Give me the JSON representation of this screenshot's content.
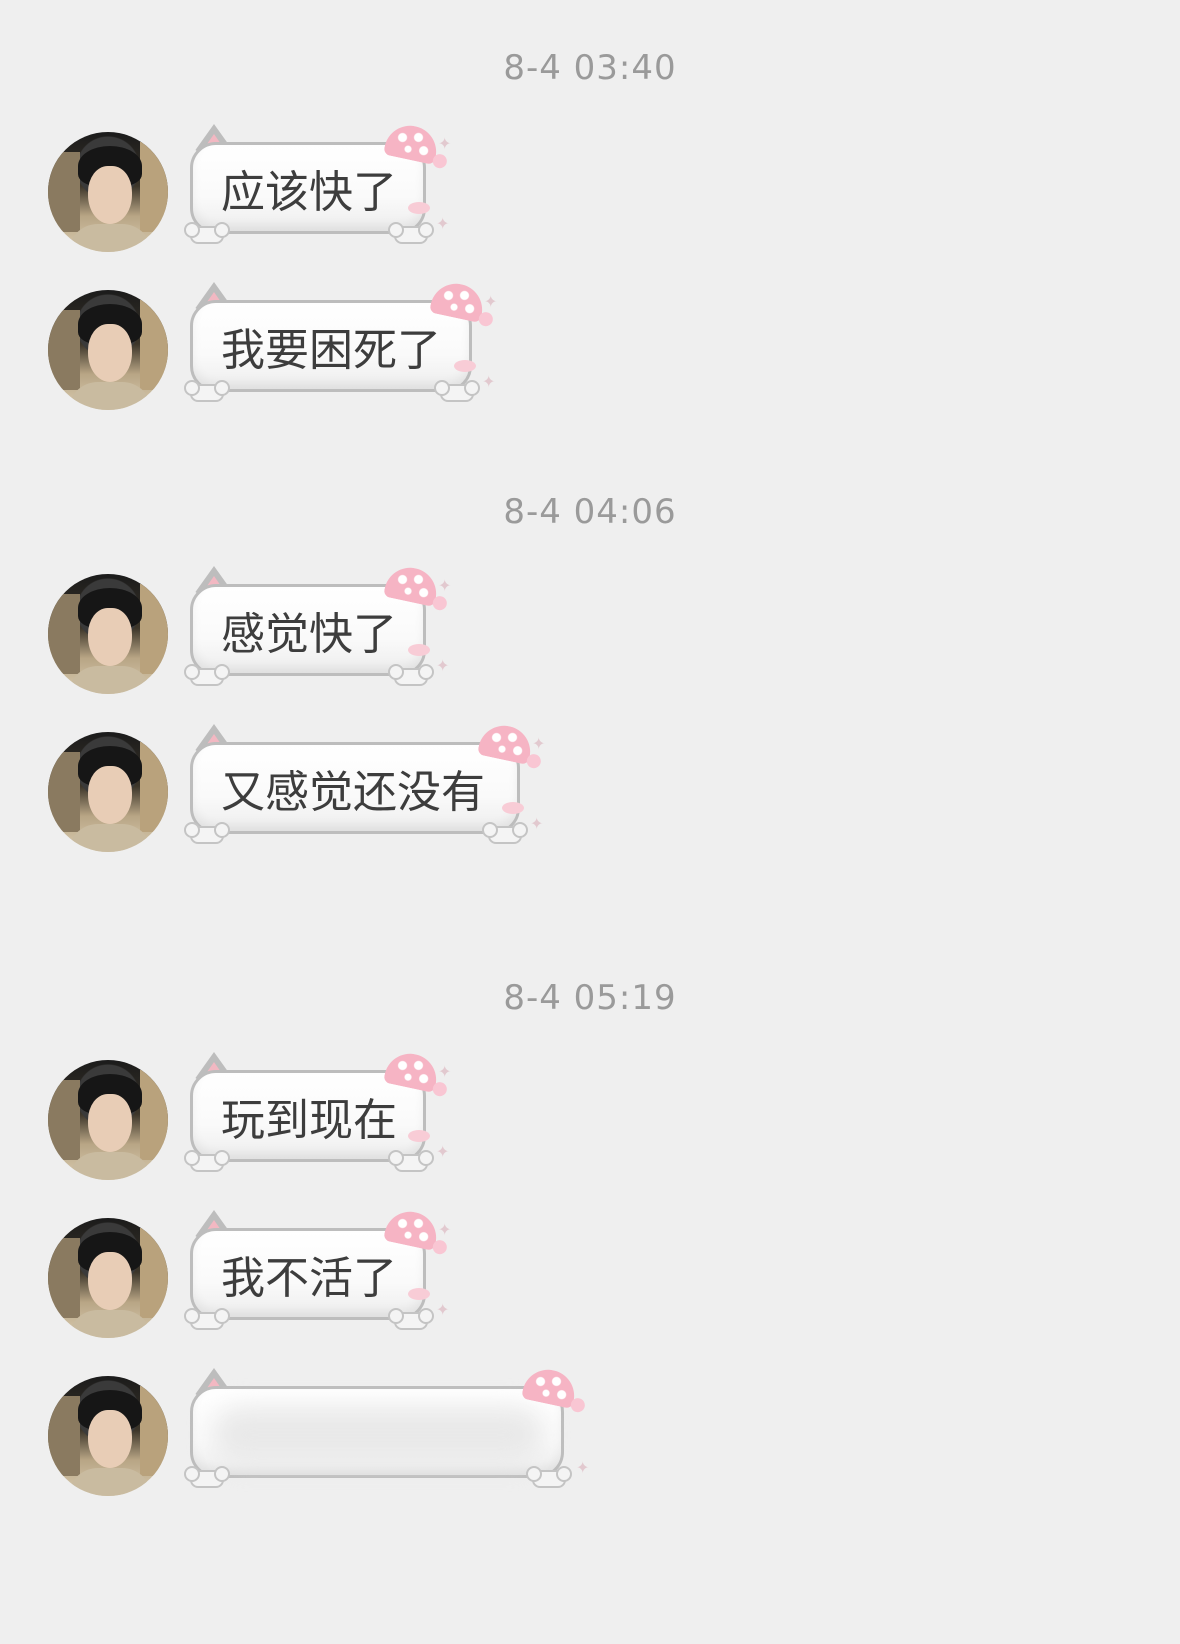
{
  "timestamps": [
    "8-4 03:40",
    "8-4 04:06",
    "8-4 05:19"
  ],
  "messages": [
    {
      "text": "应该快了"
    },
    {
      "text": "我要困死了"
    },
    {
      "text": "感觉快了"
    },
    {
      "text": "又感觉还没有"
    },
    {
      "text": "玩到现在"
    },
    {
      "text": "我不活了"
    },
    {
      "text": ""
    }
  ],
  "colors": {
    "background": "#efefef",
    "timestamp": "#9a9a9a",
    "bubble_border": "#bdbdbd",
    "accent_pink": "#f6b4c4"
  }
}
